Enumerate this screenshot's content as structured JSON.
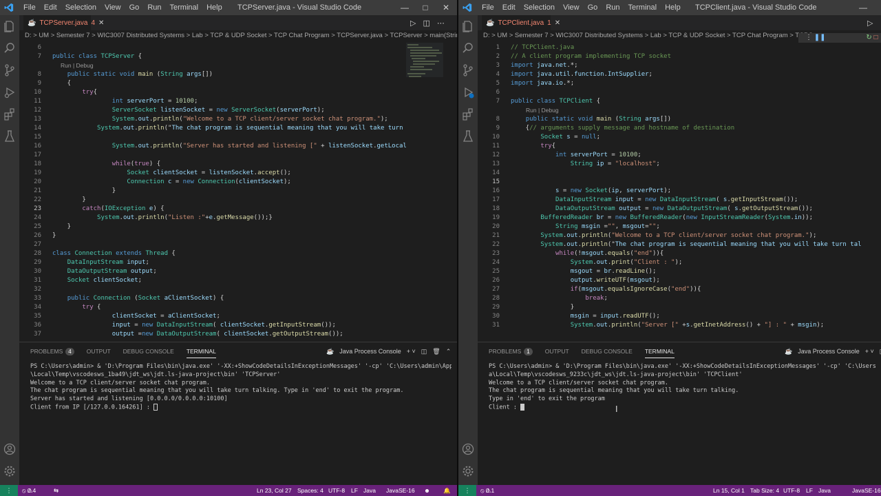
{
  "left": {
    "window_title": "TCPServer.java - Visual Studio Code",
    "menu": [
      "File",
      "Edit",
      "Selection",
      "View",
      "Go",
      "Run",
      "Terminal",
      "Help"
    ],
    "tab": {
      "label": "TCPServer.java",
      "badge": "4"
    },
    "breadcrumb": "D: > UM > Semester 7 > WIC3007 Distributed Systems > Lab > TCP & UDP Socket > TCP Chat Program > TCPServer.java > TCPServer > main(Strin",
    "code_lens": "Run | Debug",
    "line_numbers": [
      "6",
      "7",
      "8",
      "9",
      "10",
      "11",
      "12",
      "13",
      "14",
      "15",
      "16",
      "17",
      "18",
      "19",
      "20",
      "21",
      "22",
      "23",
      "24",
      "25",
      "26",
      "27",
      "28",
      "29",
      "30",
      "31",
      "32",
      "33",
      "34",
      "35",
      "36",
      "37"
    ],
    "code": [
      "",
      "public class TCPServer {",
      "    public static void main (String args[])",
      "    {",
      "        try{",
      "                int serverPort = 10100;",
      "                ServerSocket listenSocket = new ServerSocket(serverPort);",
      "                System.out.println(\"Welcome to a TCP client/server socket chat program.\");",
      "            System.out.println(\"The chat program is sequential meaning that you will take turn talk",
      "",
      "                System.out.println(\"Server has started and listening [\" + listenSocket.getLocalSock",
      "",
      "                while(true) {",
      "                    Socket clientSocket = listenSocket.accept();",
      "                    Connection c = new Connection(clientSocket);",
      "                }",
      "        }",
      "        catch(IOException e) {",
      "            System.out.println(\"Listen :\"+e.getMessage());}",
      "    }",
      "}",
      "",
      "class Connection extends Thread {",
      "    DataInputStream input;",
      "    DataOutputStream output;",
      "    Socket clientSocket;",
      "",
      "    public Connection (Socket aClientSocket) {",
      "        try {",
      "                clientSocket = aClientSocket;",
      "                input = new DataInputStream( clientSocket.getInputStream());",
      "                output =new DataOutputStream( clientSocket.getOutputStream());"
    ],
    "panel_tabs": [
      "PROBLEMS",
      "OUTPUT",
      "DEBUG CONSOLE",
      "TERMINAL"
    ],
    "problems_count": "4",
    "console_label": "Java Process Console",
    "terminal": [
      "PS C:\\Users\\admin> & 'D:\\Program Files\\bin\\java.exe' '-XX:+ShowCodeDetailsInExceptionMessages' '-cp' 'C:\\Users\\admin\\AppData",
      "\\Local\\Temp\\vscodesws_1ba49\\jdt_ws\\jdt.ls-java-project\\bin' 'TCPServer'",
      "Welcome to a TCP client/server socket chat program.",
      "The chat program is sequential meaning that you will take turn talking. Type in 'end' to exit the program.",
      "Server has started and listening [0.0.0.0/0.0.0.0:10100]",
      "Client from IP [/127.0.0.164261] : "
    ],
    "status": {
      "errors": "0",
      "warnings": "4",
      "position": "Ln 23, Col 27",
      "spaces": "Spaces: 4",
      "encoding": "UTF-8",
      "eol": "LF",
      "lang": "Java",
      "jdk": "JavaSE-16"
    }
  },
  "right": {
    "window_title": "TCPClient.java - Visual Studio Code",
    "menu": [
      "File",
      "Edit",
      "Selection",
      "View",
      "Go",
      "Run",
      "Terminal",
      "Help"
    ],
    "tab": {
      "label": "TCPClient.java",
      "badge": "1"
    },
    "breadcrumb": "D: > UM > Semester 7 > WIC3007 Distributed Systems > Lab > TCP & UDP Socket > TCP Chat Program > TCPC",
    "code_lens": "Run | Debug",
    "line_numbers": [
      "1",
      "2",
      "3",
      "4",
      "5",
      "6",
      "7",
      "8",
      "9",
      "10",
      "11",
      "12",
      "13",
      "14",
      "15",
      "16",
      "17",
      "18",
      "19",
      "20",
      "21",
      "22",
      "23",
      "24",
      "25",
      "26",
      "27",
      "28",
      "29",
      "30",
      "31"
    ],
    "code": [
      "// TCPClient.java",
      "// A client program implementing TCP socket",
      "import java.net.*;",
      "import java.util.function.IntSupplier;",
      "import java.io.*;",
      "",
      "public class TCPClient {",
      "    public static void main (String args[])",
      "    {// arguments supply message and hostname of destination",
      "        Socket s = null;",
      "        try{",
      "            int serverPort = 10100;",
      "                String ip = \"localhost\";",
      "",
      "",
      "            s = new Socket(ip, serverPort);",
      "            DataInputStream input = new DataInputStream( s.getInputStream());",
      "            DataOutputStream output = new DataOutputStream( s.getOutputStream());",
      "        BufferedReader br = new BufferedReader(new InputStreamReader(System.in));",
      "            String msgin =\"\", msgout=\"\";",
      "        System.out.println(\"Welcome to a TCP client/server socket chat program.\");",
      "        System.out.println(\"The chat program is sequential meaning that you will take turn tal",
      "            while(!msgout.equals(\"end\")){",
      "                System.out.print(\"Client : \");",
      "                msgout = br.readLine();",
      "                output.writeUTF(msgout);",
      "                if(msgout.equalsIgnoreCase(\"end\")){",
      "                    break;",
      "                }",
      "                msgin = input.readUTF();",
      "                System.out.println(\"Server [\" +s.getInetAddress() + \"] : \" + msgin);"
    ],
    "panel_tabs": [
      "PROBLEMS",
      "OUTPUT",
      "DEBUG CONSOLE",
      "TERMINAL"
    ],
    "problems_count": "1",
    "console_label": "Java Process Console",
    "terminal": [
      "PS C:\\Users\\admin> & 'D:\\Program Files\\bin\\java.exe' '-XX:+ShowCodeDetailsInExceptionMessages' '-cp' 'C:\\Users\\admin",
      "a\\Local\\Temp\\vscodesws_9233c\\jdt_ws\\jdt.ls-java-project\\bin' 'TCPClient'",
      "Welcome to a TCP client/server socket chat program.",
      "The chat program is sequential meaning that you will take turn talking.",
      "Type in 'end' to exit the program",
      "Client : "
    ],
    "status": {
      "errors": "0",
      "warnings": "1",
      "position": "Ln 15, Col 1",
      "spaces": "Tab Size: 4",
      "encoding": "UTF-8",
      "eol": "LF",
      "lang": "Java",
      "jdk": "JavaSE-16"
    }
  },
  "colors": {
    "statusbar": "#68217a",
    "titlebar": "#3c3c3c",
    "activity": "#333333",
    "editor_bg": "#1e1e1e",
    "remote": "#16825d"
  },
  "icons": [
    "explorer-icon",
    "search-icon",
    "source-control-icon",
    "run-debug-icon",
    "extensions-icon",
    "testing-icon",
    "account-icon",
    "settings-gear-icon"
  ]
}
